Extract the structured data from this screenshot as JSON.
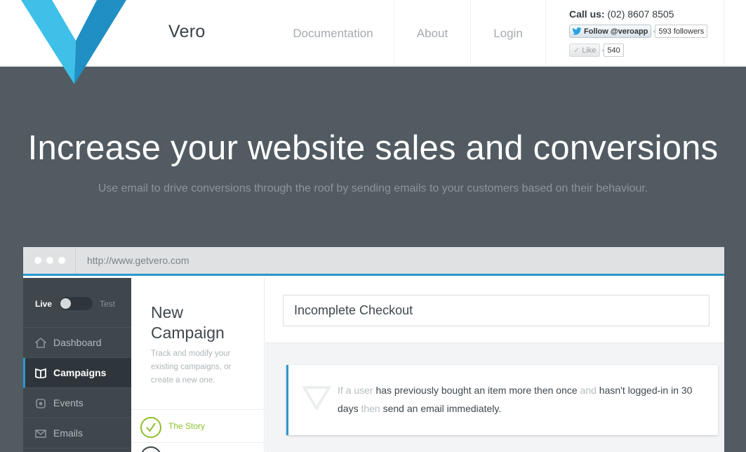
{
  "header": {
    "brand": "Vero",
    "nav": [
      "Documentation",
      "About",
      "Login"
    ],
    "call_label": "Call us:",
    "phone": "(02) 8607 8505",
    "twitter_follow": "Follow @veroapp",
    "twitter_count": "593 followers",
    "like_label": "Like",
    "like_count": "540"
  },
  "hero": {
    "title": "Increase your website sales and conversions",
    "subtitle": "Use email to drive conversions through the roof by sending emails to your customers based on their behaviour."
  },
  "browser": {
    "url": "http://www.getvero.com"
  },
  "app": {
    "toggle_live": "Live",
    "toggle_test": "Test",
    "sidebar": [
      "Dashboard",
      "Campaigns",
      "Events",
      "Emails"
    ],
    "panel_title": "New Campaign",
    "panel_desc": "Track and modify your existing campaigns, or create a new one.",
    "step_1": "The Story",
    "campaign_name": "Incomplete Checkout",
    "story": {
      "p1": "If a user ",
      "p2": "has previously bought an item more then once",
      "p3": " and ",
      "p4": "hasn't logged-in in 30 days",
      "p5": " then ",
      "p6": "send an email immediately."
    }
  },
  "colors": {
    "hero_bg": "#525b62",
    "accent_blue": "#2a96d0",
    "logo_blue": "#3ab6e2",
    "step_green": "#8fbf2f",
    "sidebar_bg": "#3f474d"
  }
}
